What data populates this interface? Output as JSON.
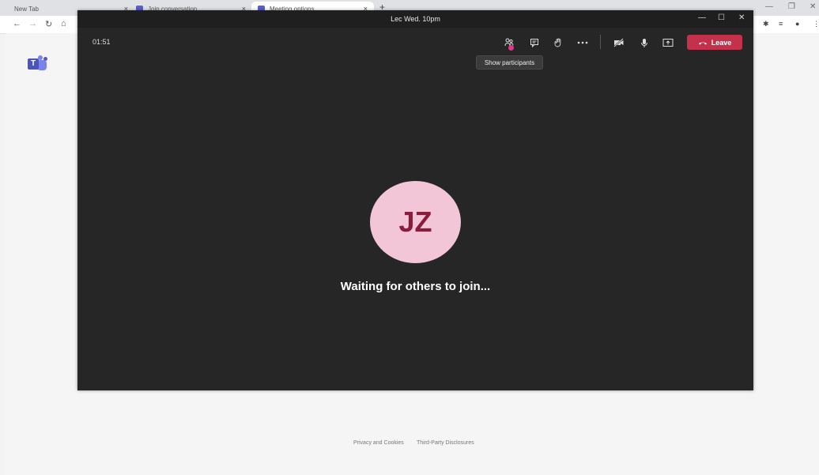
{
  "browser": {
    "tabs": [
      {
        "label": "New Tab"
      },
      {
        "label": "Join conversation"
      },
      {
        "label": "Meeting options"
      }
    ],
    "new_tab_symbol": "+",
    "close_symbol": "×"
  },
  "meeting": {
    "title": "Lec Wed. 10pm",
    "timer": "01:51",
    "tooltip": "Show participants",
    "leave_label": "Leave",
    "avatar_initials": "JZ",
    "status_text": "Waiting for others to join..."
  },
  "footer": {
    "privacy": "Privacy and Cookies",
    "third_party": "Third-Party Disclosures"
  },
  "colors": {
    "leave": "#c4314b",
    "avatar_bg": "#f2c6d6",
    "avatar_text": "#8a1c3d",
    "meeting_bg": "#262626"
  }
}
